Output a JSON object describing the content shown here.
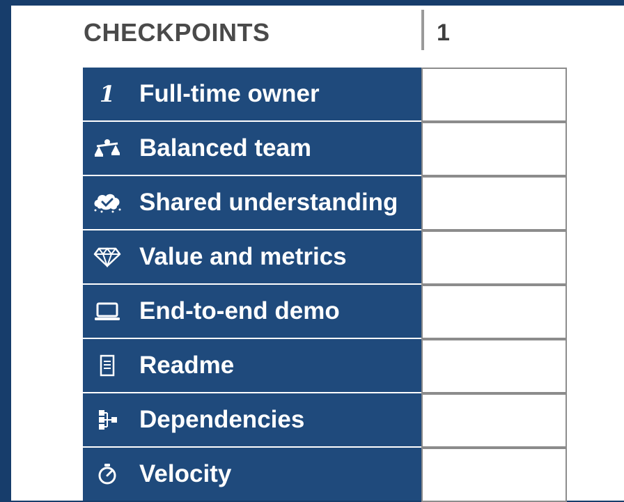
{
  "header": {
    "title": "CHECKPOINTS",
    "column_label": "1"
  },
  "colors": {
    "background": "#173d6b",
    "row_fill": "#1f4a7c",
    "header_text": "#4a4a4a"
  },
  "checkpoints": [
    {
      "icon": "number-one-icon",
      "icon_text": "1",
      "label": "Full-time owner"
    },
    {
      "icon": "balance-scale-icon",
      "label": "Balanced team"
    },
    {
      "icon": "brain-cloud-check-icon",
      "label": "Shared understanding"
    },
    {
      "icon": "diamond-icon",
      "label": "Value and metrics"
    },
    {
      "icon": "laptop-icon",
      "label": "End-to-end demo"
    },
    {
      "icon": "document-icon",
      "label": "Readme"
    },
    {
      "icon": "hierarchy-icon",
      "label": "Dependencies"
    },
    {
      "icon": "stopwatch-icon",
      "label": "Velocity"
    }
  ]
}
